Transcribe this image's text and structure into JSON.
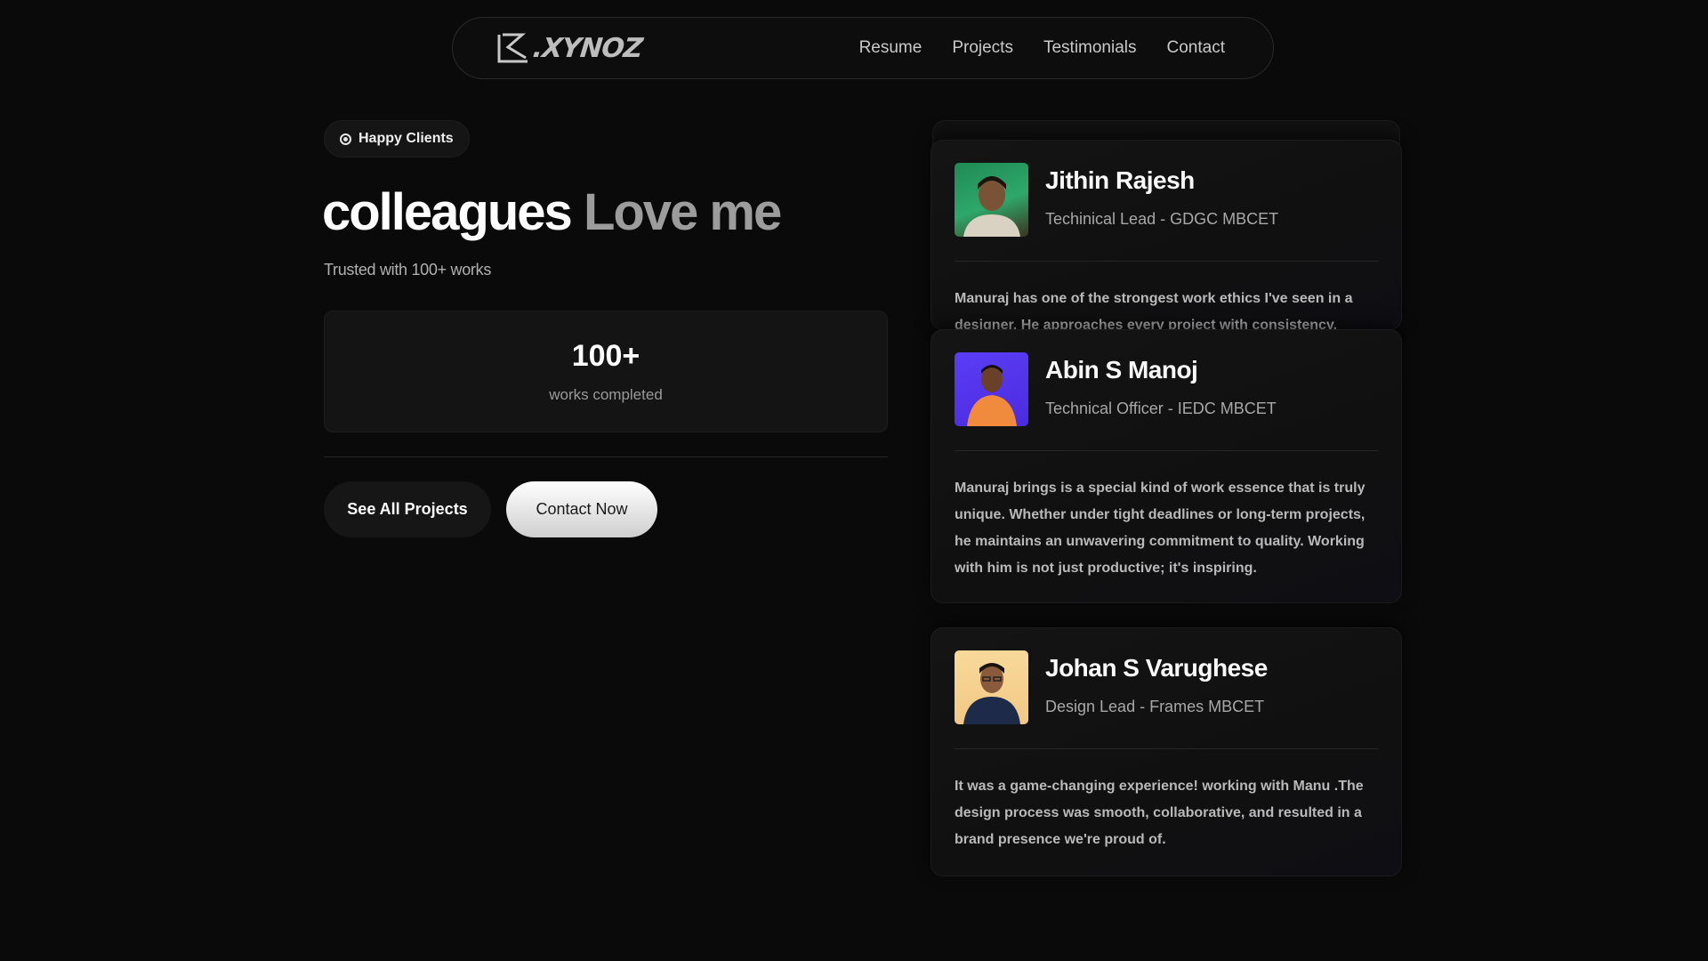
{
  "nav": {
    "logo_text": ".XYNOZ",
    "links": [
      "Resume",
      "Projects",
      "Testimonials",
      "Contact"
    ]
  },
  "hero": {
    "badge": "Happy Clients",
    "headline_strong": "colleagues",
    "headline_soft": "Love me",
    "subtext": "Trusted with 100+ works"
  },
  "stat": {
    "value": "100+",
    "label": "works completed"
  },
  "buttons": {
    "see_all": "See All Projects",
    "contact": "Contact Now"
  },
  "testimonials": [
    {
      "name": "Jithin Rajesh",
      "role": "Techinical Lead - GDGC MBCET",
      "quote": "Manuraj has one of the strongest work ethics I've seen in a designer. He approaches every project with consistency."
    },
    {
      "name": "Abin S Manoj",
      "role": "Technical Officer - IEDC MBCET",
      "quote": "Manuraj brings is a special kind of work essence that is truly unique. Whether under tight deadlines or long-term projects, he maintains an unwavering commitment to quality. Working with him is not just productive; it's inspiring."
    },
    {
      "name": "Johan S Varughese",
      "role": "Design Lead - Frames MBCET",
      "quote": "It was a game-changing experience!  working with Manu .The design process was smooth, collaborative, and resulted in a brand presence we're proud of."
    }
  ],
  "colors": {
    "background": "#0a0a0a",
    "card": "#141414",
    "avatar_1": "#2ea86a",
    "avatar_2": "#5b3df5",
    "avatar_3": "#f2c884"
  }
}
